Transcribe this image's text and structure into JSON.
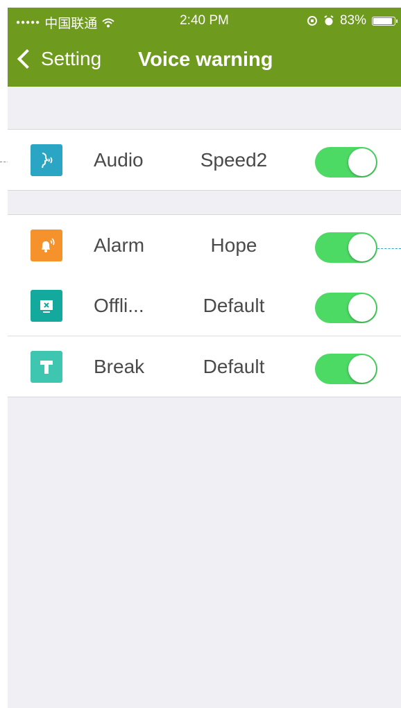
{
  "status_bar": {
    "signal_dots": "●●●●●",
    "carrier": "中国联通",
    "wifi_icon": "wifi-icon",
    "time": "2:40 PM",
    "battery_percent": "83%",
    "battery_level": 0.83
  },
  "nav": {
    "back_label": "Setting",
    "title": "Voice warning"
  },
  "colors": {
    "accent": "#6e9a1e",
    "toggle_on": "#4cd964",
    "audio_icon": "#2aa6c4",
    "alarm_icon": "#f5922b",
    "offline_icon": "#13a99c",
    "break_icon": "#3ec6b0",
    "callout": "#2aa6c4"
  },
  "rows": [
    {
      "icon": "audio-voice-icon",
      "label": "Audio",
      "value": "Speed2",
      "enabled": true
    },
    {
      "icon": "alarm-bell-icon",
      "label": "Alarm",
      "value": "Hope",
      "enabled": true
    },
    {
      "icon": "offline-screen-icon",
      "label": "Offli...",
      "value": "Default",
      "enabled": true
    },
    {
      "icon": "break-hammer-icon",
      "label": "Break",
      "value": "Default",
      "enabled": true
    }
  ]
}
